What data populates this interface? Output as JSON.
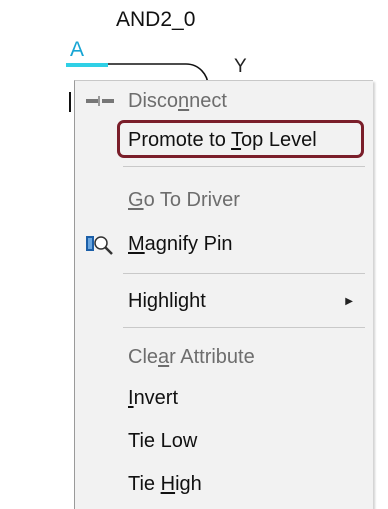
{
  "schematic": {
    "gate_instance": "AND2_0",
    "pin_label": "A",
    "output_label": "Y"
  },
  "context_menu": {
    "items": [
      {
        "id": "disconnect",
        "before": "Disco",
        "mnemonic": "n",
        "after": "nect",
        "enabled": false,
        "icon": "disconnect-icon"
      },
      {
        "id": "promote",
        "before": "Promote to ",
        "mnemonic": "T",
        "after": "op Level",
        "enabled": true,
        "outlined": true
      },
      {
        "id": "go-to-driver",
        "before": "",
        "mnemonic": "G",
        "after": "o To Driver",
        "enabled": false
      },
      {
        "id": "magnify-pin",
        "before": "",
        "mnemonic": "M",
        "after": "agnify Pin",
        "enabled": true,
        "icon": "magnify-pin-icon"
      },
      {
        "id": "highlight",
        "before": "Highlight",
        "mnemonic": "",
        "after": "",
        "enabled": true,
        "submenu": true
      },
      {
        "id": "clear-attribute",
        "before": "Cle",
        "mnemonic": "a",
        "after": "r Attribute",
        "enabled": false
      },
      {
        "id": "invert",
        "before": "",
        "mnemonic": "I",
        "after": "nvert",
        "enabled": true
      },
      {
        "id": "tie-low",
        "before": "Tie Low",
        "mnemonic": "",
        "after": "",
        "enabled": true
      },
      {
        "id": "tie-high",
        "before": "Tie ",
        "mnemonic": "H",
        "after": "igh",
        "enabled": true
      }
    ],
    "submenu_arrow": "▶"
  },
  "colors": {
    "pin_label": "#17a5d4",
    "wire": "#2fd0e6",
    "outline": "#7a1e2a",
    "disabled_text": "#6d6d6d",
    "menu_bg": "#f2f2f2"
  }
}
